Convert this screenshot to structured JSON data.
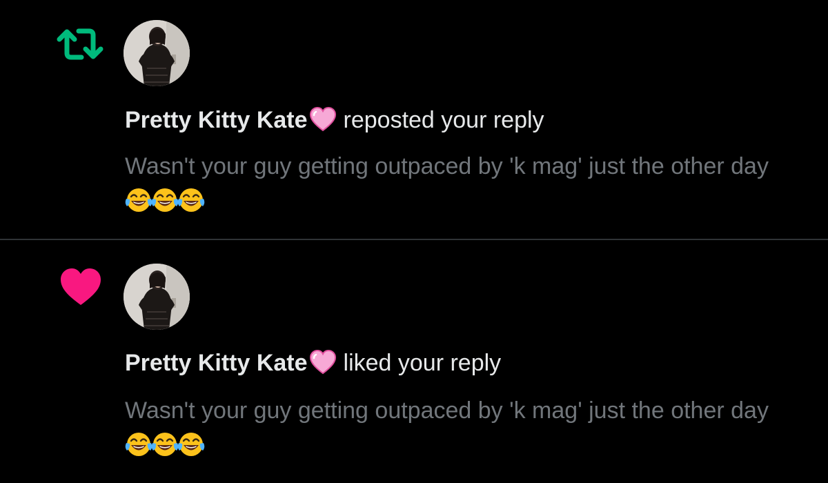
{
  "notifications": [
    {
      "type": "repost",
      "type_icon": "repost-icon",
      "accent_color": "#00ba7c",
      "user_name": "Pretty Kitty Kate",
      "name_badge": "pink-heart-emoji",
      "action": "reposted your reply",
      "text": "Wasn't your guy getting outpaced by 'k mag' just the other day",
      "trailing_emojis": [
        "face-with-tears-of-joy",
        "face-with-tears-of-joy",
        "face-with-tears-of-joy"
      ]
    },
    {
      "type": "like",
      "type_icon": "heart-icon",
      "accent_color": "#f91880",
      "user_name": "Pretty Kitty Kate",
      "name_badge": "pink-heart-emoji",
      "action": "liked your reply",
      "text": "Wasn't your guy getting outpaced by 'k mag' just the other day",
      "trailing_emojis": [
        "face-with-tears-of-joy",
        "face-with-tears-of-joy",
        "face-with-tears-of-joy"
      ]
    }
  ],
  "colors": {
    "background": "#000000",
    "primary_text": "#e7e9ea",
    "secondary_text": "#71767b",
    "divider": "#2f3336"
  }
}
